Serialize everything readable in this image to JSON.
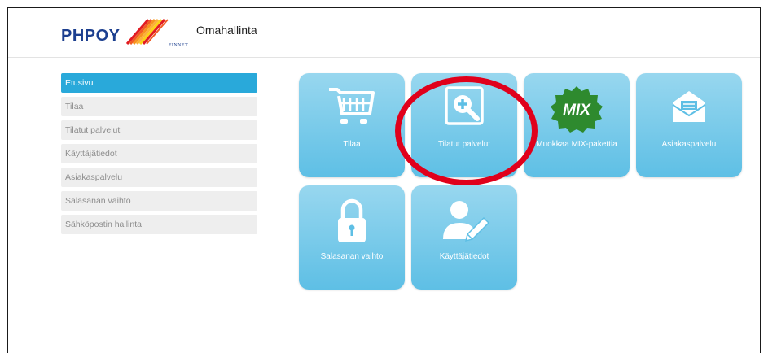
{
  "header": {
    "brand": "PHPOY",
    "brand_sub": "FINNET",
    "title": "Omahallinta"
  },
  "sidebar": {
    "items": [
      {
        "label": "Etusivu",
        "active": true
      },
      {
        "label": "Tilaa"
      },
      {
        "label": "Tilatut palvelut"
      },
      {
        "label": "Käyttäjätiedot"
      },
      {
        "label": "Asiakaspalvelu"
      },
      {
        "label": "Salasanan vaihto"
      },
      {
        "label": "Sähköpostin hallinta"
      }
    ]
  },
  "tiles": [
    {
      "label": "Tilaa",
      "icon": "shopping-cart-icon"
    },
    {
      "label": "Tilatut palvelut",
      "icon": "magnify-plus-icon"
    },
    {
      "label": "Muokkaa MIX-pakettia",
      "icon": "mix-badge-icon",
      "badge_text": "MIX"
    },
    {
      "label": "Asiakaspalvelu",
      "icon": "envelope-icon"
    },
    {
      "label": "Salasanan vaihto",
      "icon": "padlock-icon"
    },
    {
      "label": "Käyttäjätiedot",
      "icon": "user-edit-icon"
    }
  ],
  "colors": {
    "brand": "#1c3f8f",
    "sidebar_active": "#29a9da",
    "tile_top": "#98d7ef",
    "tile_bottom": "#5ebfe5",
    "highlight_circle": "#e0001b",
    "mix_badge": "#2e8a2e"
  }
}
